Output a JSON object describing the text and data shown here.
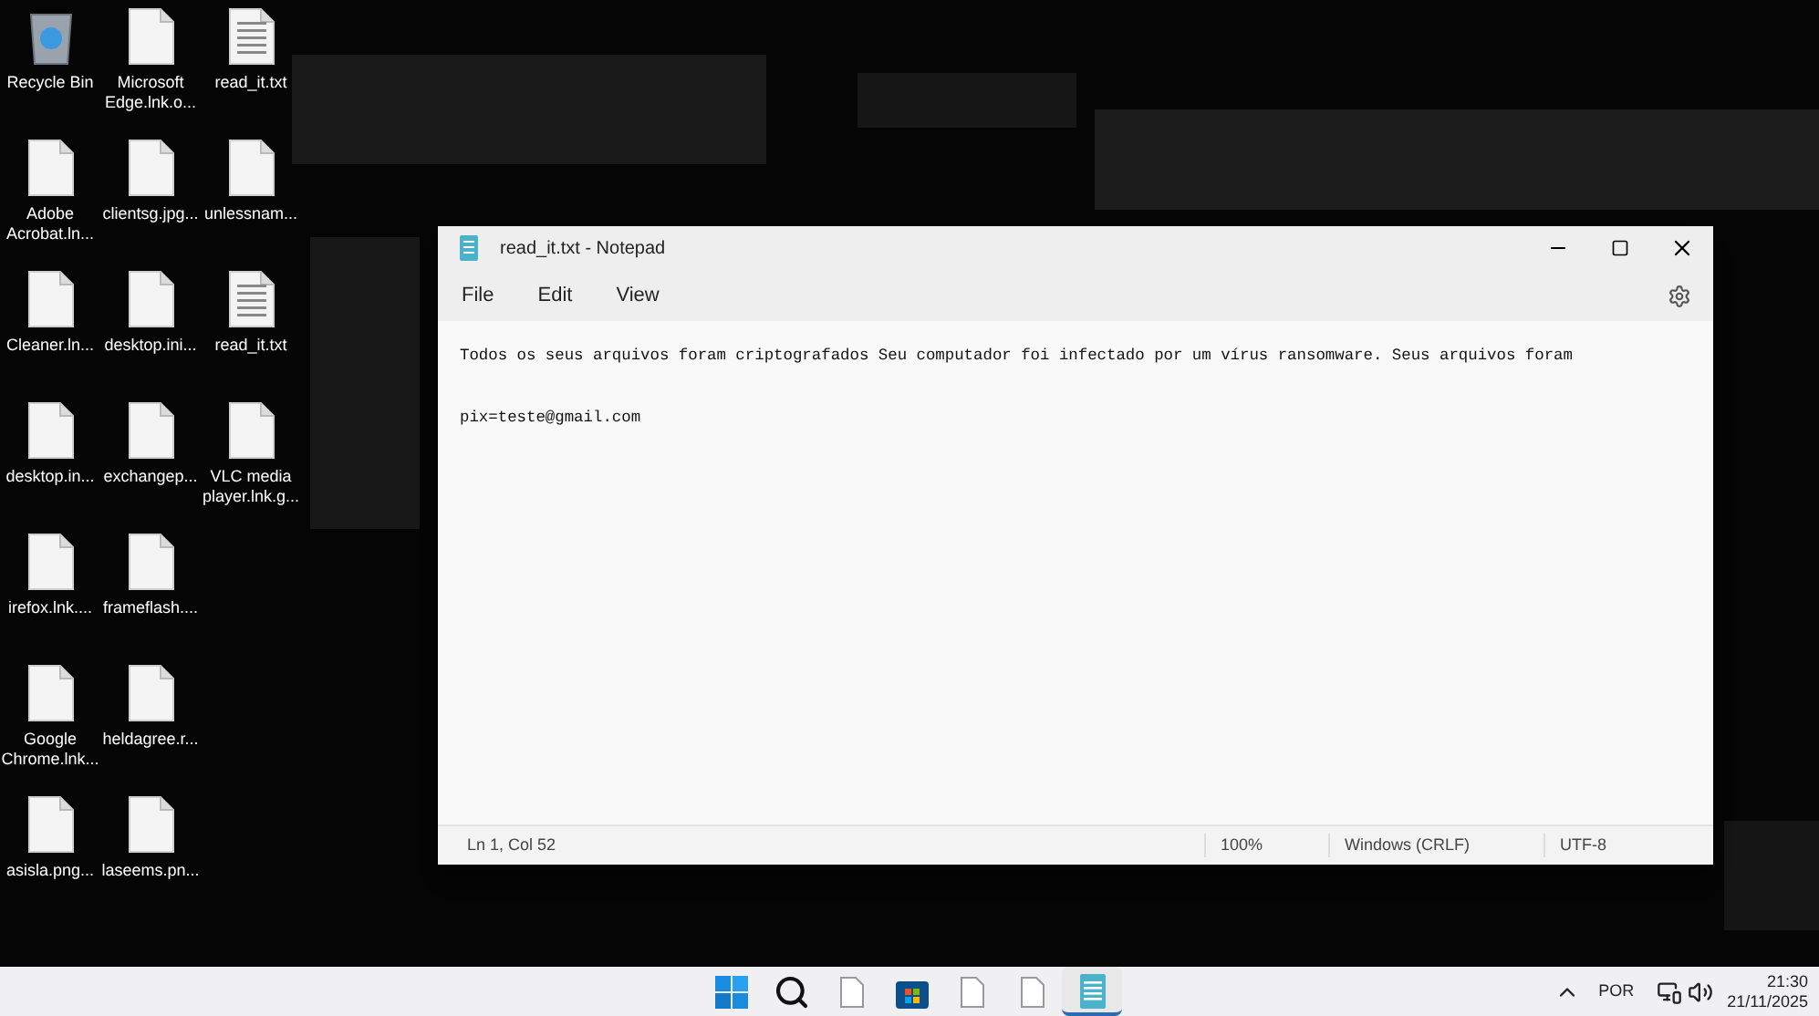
{
  "desktop_icons": [
    {
      "label": "Recycle Bin",
      "kind": "recycle"
    },
    {
      "label": "Microsoft Edge.lnk.o...",
      "kind": "file"
    },
    {
      "label": "read_it.txt",
      "kind": "text"
    },
    {
      "label": "Adobe Acrobat.ln...",
      "kind": "file"
    },
    {
      "label": "clientsg.jpg...",
      "kind": "file"
    },
    {
      "label": "unlessnam...",
      "kind": "file"
    },
    {
      "label": "Cleaner.ln...",
      "kind": "file"
    },
    {
      "label": "desktop.ini...",
      "kind": "file"
    },
    {
      "label": "read_it.txt",
      "kind": "text"
    },
    {
      "label": "desktop.in...",
      "kind": "file"
    },
    {
      "label": "exchangep...",
      "kind": "file"
    },
    {
      "label": "VLC media player.lnk.g...",
      "kind": "file"
    },
    {
      "label": "irefox.lnk....",
      "kind": "file"
    },
    {
      "label": "frameflash....",
      "kind": "file"
    },
    {
      "kind": "none"
    },
    {
      "label": "Google Chrome.lnk...",
      "kind": "file"
    },
    {
      "label": "heldagree.r...",
      "kind": "file"
    },
    {
      "kind": "none"
    },
    {
      "label": "asisla.png...",
      "kind": "file"
    },
    {
      "label": "laseems.pn...",
      "kind": "file"
    }
  ],
  "notepad": {
    "title": "read_it.txt - Notepad",
    "menu": [
      "File",
      "Edit",
      "View"
    ],
    "lines": [
      "Todos os seus arquivos foram criptografados Seu computador foi infectado por um vírus ransomware. Seus arquivos foram",
      "pix=teste@gmail.com"
    ],
    "status": [
      "Ln 1, Col 52",
      "100%",
      "Windows (CRLF)",
      "UTF-8"
    ]
  },
  "taskbar": {
    "apps": [
      {
        "kind": "start",
        "selected": false
      },
      {
        "kind": "search",
        "selected": false
      },
      {
        "kind": "file",
        "selected": false
      },
      {
        "kind": "store",
        "selected": false
      },
      {
        "kind": "file",
        "selected": false
      },
      {
        "kind": "file",
        "selected": false
      },
      {
        "kind": "notepad",
        "selected": true
      }
    ],
    "language": "POR",
    "time": "21:30",
    "date": "21/11/2025"
  }
}
